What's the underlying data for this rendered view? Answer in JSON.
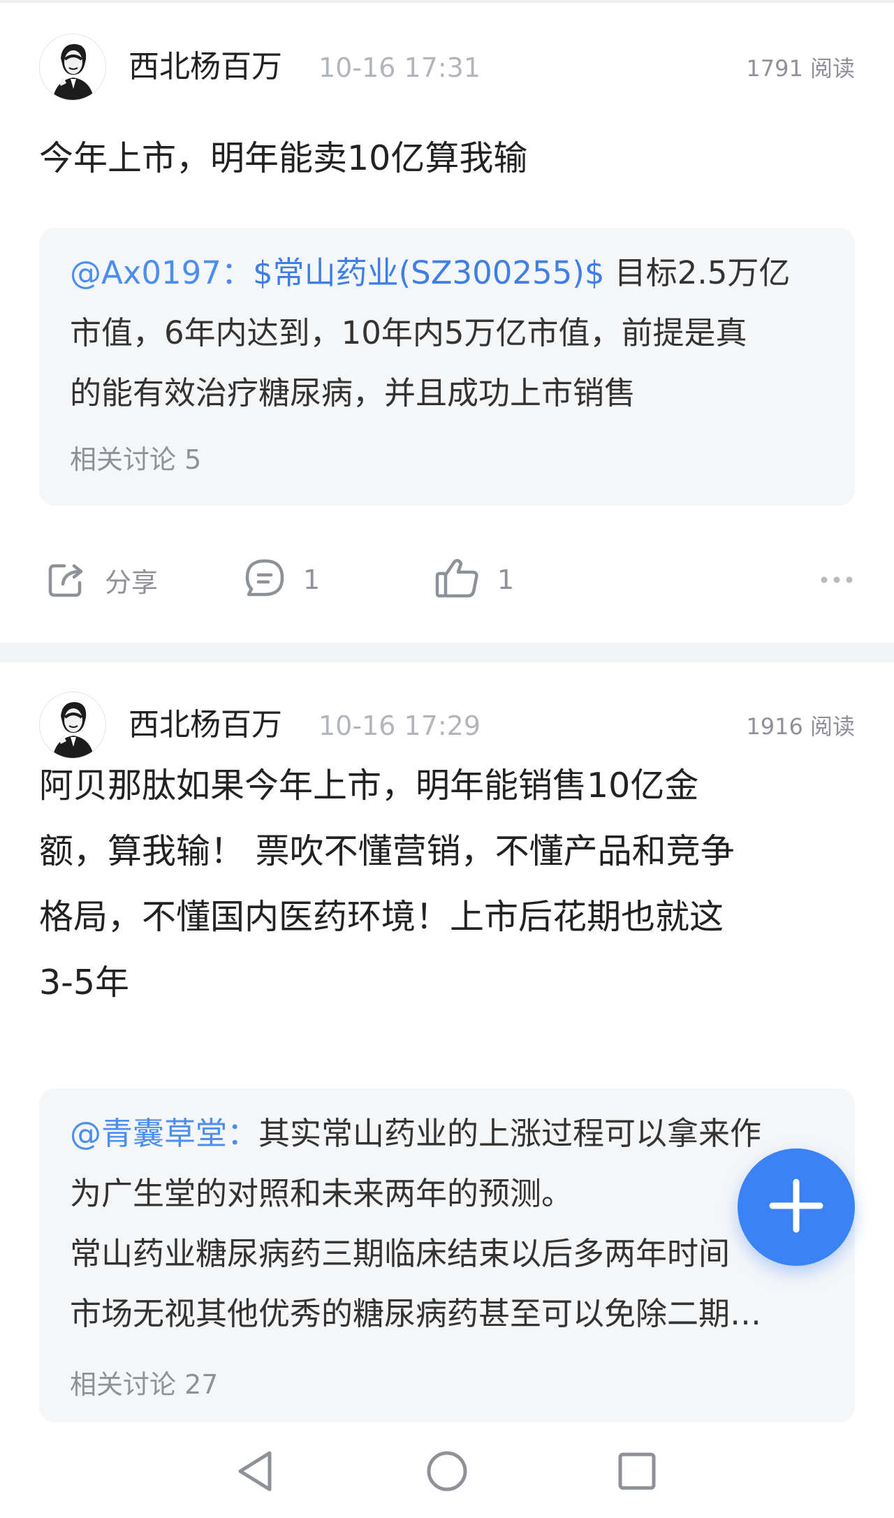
{
  "posts": [
    {
      "author": "西北杨百万",
      "time": "10-16 17:31",
      "reads": "1791 阅读",
      "text": "今年上市，明年能卖10亿算我输",
      "quote": {
        "author": "@Ax0197：",
        "stock": "$常山药业(SZ300255)$",
        "lines": [
          " 目标2.5万亿",
          "市值，6年内达到，10年内5万亿市值，前提是真",
          "的能有效治疗糖尿病，并且成功上市销售"
        ],
        "related": "相关讨论 5"
      },
      "actions": {
        "share": "分享",
        "comments": "1",
        "likes": "1"
      }
    },
    {
      "author": "西北杨百万",
      "time": "10-16 17:29",
      "reads": "1916 阅读",
      "text_lines": [
        "阿贝那肽如果今年上市，明年能销售10亿金",
        "额，算我输！ 票吹不懂营销，不懂产品和竞争",
        "格局，不懂国内医药环境！上市后花期也就这",
        "3-5年"
      ],
      "quote": {
        "author": "@青囊草堂：",
        "lines": [
          "其实常山药业的上涨过程可以拿来作",
          "为广生堂的对照和未来两年的预测。",
          "常山药业糖尿病药三期临床结束以后多两年时间",
          "市场无视其他优秀的糖尿病药甚至可以免除二期…"
        ],
        "related": "相关讨论 27"
      }
    }
  ],
  "icons": {
    "share": "share-icon",
    "comment": "comment-icon",
    "like": "thumbs-up-icon",
    "more": "more-dots-icon",
    "fab": "plus-icon",
    "nav_back": "triangle-back-icon",
    "nav_home": "circle-home-icon",
    "nav_recent": "square-recent-icon"
  },
  "colors": {
    "link": "#4a8ef2",
    "fab": "#3b82f6",
    "muted": "#8e9197"
  }
}
